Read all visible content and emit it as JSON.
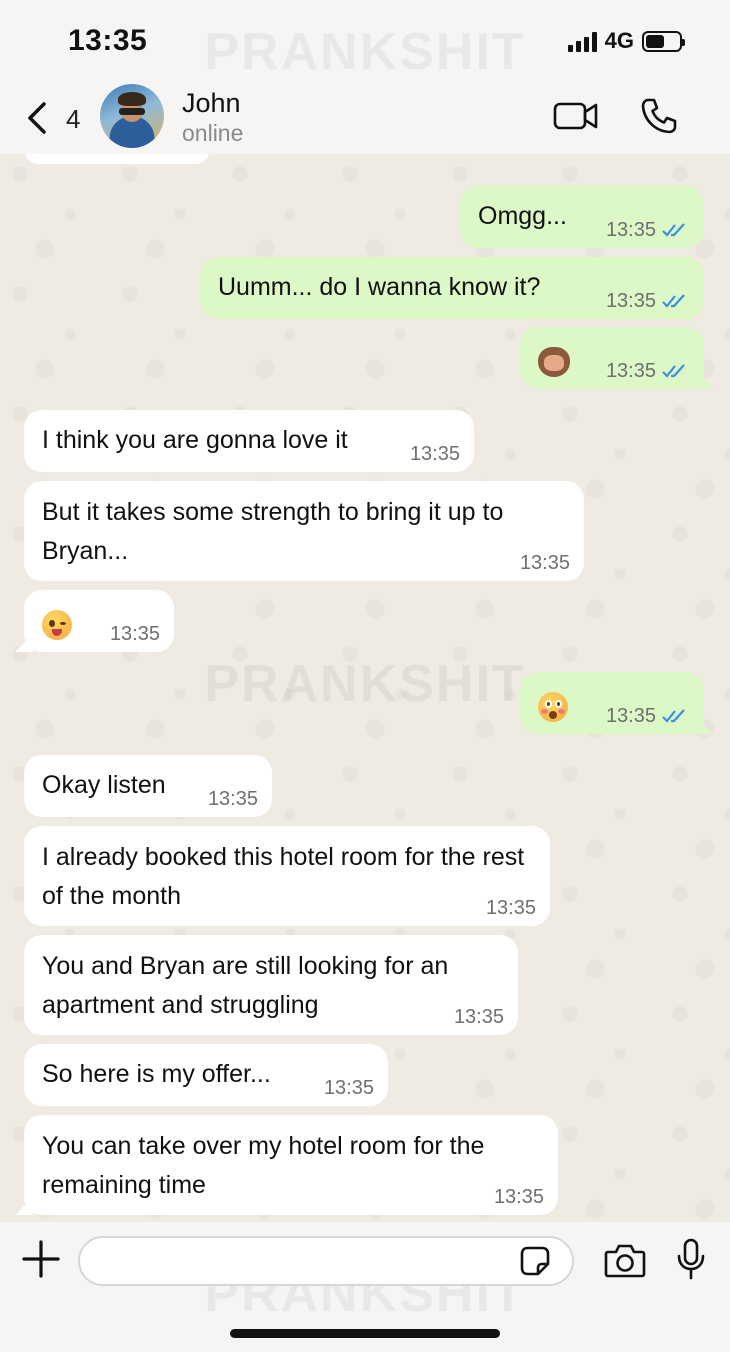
{
  "status_bar": {
    "time": "13:35",
    "network": "4G",
    "watermark": "PRANKSHIT"
  },
  "header": {
    "unread_count": "4",
    "contact_name": "John",
    "contact_status": "online"
  },
  "messages": [
    {
      "direction": "out",
      "text": "Omgg...",
      "time": "13:35",
      "read": true
    },
    {
      "direction": "out",
      "text": "Uumm... do I wanna know it?",
      "time": "13:35",
      "read": true
    },
    {
      "direction": "out",
      "emoji": "see-no-evil-monkey-emoji",
      "time": "13:35",
      "read": true
    },
    {
      "direction": "in",
      "text": "I think you are gonna love it",
      "time": "13:35"
    },
    {
      "direction": "in",
      "text": "But it takes some strength to bring it up to Bryan...",
      "time": "13:35"
    },
    {
      "direction": "in",
      "emoji": "winking-tongue-face-emoji",
      "time": "13:35"
    },
    {
      "direction": "out",
      "emoji": "flushed-face-emoji",
      "time": "13:35",
      "read": true
    },
    {
      "direction": "in",
      "text": "Okay listen",
      "time": "13:35"
    },
    {
      "direction": "in",
      "text": "I already booked this hotel room for the rest of the month",
      "time": "13:35"
    },
    {
      "direction": "in",
      "text": "You and Bryan are still looking for an apartment and struggling",
      "time": "13:35"
    },
    {
      "direction": "in",
      "text": "So here is my offer...",
      "time": "13:35"
    },
    {
      "direction": "in",
      "text": "You can take over my hotel room for the remaining time",
      "time": "13:35"
    }
  ],
  "input": {
    "value": "",
    "placeholder": ""
  },
  "colors": {
    "outgoing_bubble": "#dcf8c6",
    "incoming_bubble": "#ffffff",
    "read_ticks": "#3a8fe0",
    "chat_background": "#efeae2"
  }
}
